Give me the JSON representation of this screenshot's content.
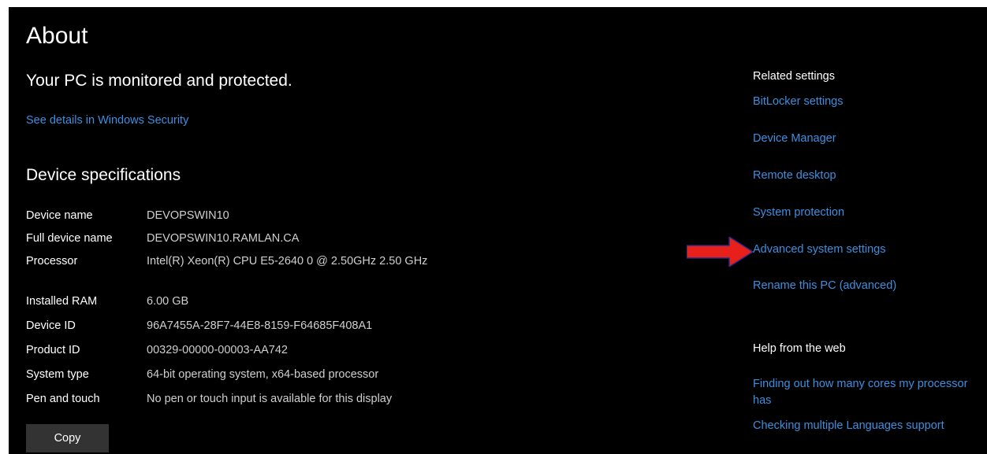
{
  "page": {
    "title": "About",
    "status_headline": "Your PC is monitored and protected.",
    "security_link": "See details in Windows Security"
  },
  "specs": {
    "title": "Device specifications",
    "rows": [
      {
        "label": "Device name",
        "value": "DEVOPSWIN10"
      },
      {
        "label": "Full device name",
        "value": "DEVOPSWIN10.RAMLAN.CA"
      },
      {
        "label": "Processor",
        "value": "Intel(R) Xeon(R) CPU E5-2640 0 @ 2.50GHz   2.50 GHz"
      },
      {
        "label": "Installed RAM",
        "value": "6.00 GB"
      },
      {
        "label": "Device ID",
        "value": "96A7455A-28F7-44E8-8159-F64685F408A1"
      },
      {
        "label": "Product ID",
        "value": "00329-00000-00003-AA742"
      },
      {
        "label": "System type",
        "value": "64-bit operating system, x64-based processor"
      },
      {
        "label": "Pen and touch",
        "value": "No pen or touch input is available for this display"
      }
    ],
    "copy_label": "Copy"
  },
  "related": {
    "heading": "Related settings",
    "links": [
      "BitLocker settings",
      "Device Manager",
      "Remote desktop",
      "System protection",
      "Advanced system settings",
      "Rename this PC (advanced)"
    ]
  },
  "help": {
    "heading": "Help from the web",
    "links": [
      "Finding out how many cores my processor has",
      "Checking multiple Languages support"
    ]
  },
  "annotation": {
    "arrow_icon": "red-arrow-right-icon",
    "arrow_color": "#e8201c"
  },
  "colors": {
    "background": "#000000",
    "link": "#3d8fe0",
    "button": "#333333"
  }
}
